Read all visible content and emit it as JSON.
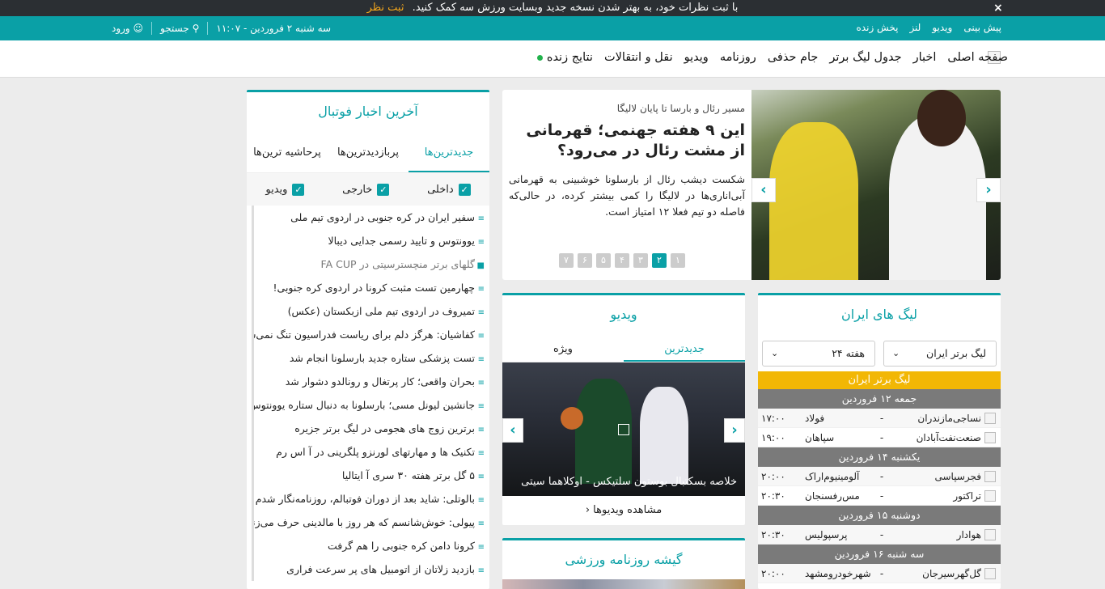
{
  "top_banner": {
    "message": "با ثبت نظرات خود، به بهتر شدن نسخه جدید وبسایت ورزش سه کمک کنید.",
    "link": "ثبت نظر",
    "close": "×"
  },
  "utility_bar": {
    "links": [
      "پیش بینی",
      "ویدیو",
      "لنز",
      "پخش زنده"
    ],
    "date_time": "سه شنبه ۲ فروردین - ۱۱:۰۷",
    "search": "جستجو",
    "login": "ورود"
  },
  "main_nav": {
    "items": [
      "صفحه اصلی",
      "اخبار",
      "جدول لیگ برتر",
      "جام حذفی",
      "روزنامه",
      "ویدیو",
      "نقل و انتقالات",
      "نتایج زنده"
    ]
  },
  "hero": {
    "kicker": "مسیر رئال و بارسا تا پایان لالیگا",
    "title": "این ۹ هفته جهنمی؛ قهرمانی از مشت رئال در می‌رود؟",
    "summary": "شکست دیشب رئال از بارسلونا خوشبینی به قهرمانی آبی‌اناری‌ها در لالیگا را کمی بیشتر کرده، در حالی‌که فاصله دو تیم فعلا ۱۲ امتیاز است.",
    "pages": [
      "۷",
      "۶",
      "۵",
      "۴",
      "۳",
      "۲",
      "۱"
    ],
    "active_page": "۲",
    "next": "›",
    "prev": "‹"
  },
  "latest_news": {
    "title": "آخرین اخبار فوتبال",
    "tabs": [
      "جدیدترین‌ها",
      "پربازدیدترین‌ها",
      "پرحاشیه ترین‌ها"
    ],
    "filters": [
      "داخلی",
      "خارجی",
      "ویدیو"
    ],
    "items": [
      {
        "text": "سفیر ایران در کره جنوبی در اردوی تیم ملی",
        "type": "text"
      },
      {
        "text": "یوونتوس و تایید رسمی جدایی دیبالا",
        "type": "text"
      },
      {
        "text": "گلهای برتر منچسترسیتی در FA CUP",
        "type": "video"
      },
      {
        "text": "چهارمین تست مثبت کرونا در اردوی کره جنوبی!",
        "type": "text"
      },
      {
        "text": "تمیروف در اردوی تیم ملی ازبکستان (عکس)",
        "type": "text"
      },
      {
        "text": "کفاشیان: هرگز دلم برای ریاست فدراسیون تنگ نمی‌شود",
        "type": "text"
      },
      {
        "text": "تست پزشکی ستاره جدید بارسلونا انجام شد",
        "type": "text"
      },
      {
        "text": "بحران واقعی؛ کار پرتغال و رونالدو دشوار شد",
        "type": "text"
      },
      {
        "text": "جانشین لیونل مسی؛ بارسلونا به دنبال ستاره یوونتوس",
        "type": "text"
      },
      {
        "text": "برترین زوج های هجومی در لیگ برتر جزیره",
        "type": "text"
      },
      {
        "text": "تکنیک ها و مهارتهای لورنزو پلگرینی در آ اس رم",
        "type": "text"
      },
      {
        "text": "۵ گل برتر هفته ۳۰ سری آ ایتالیا",
        "type": "text"
      },
      {
        "text": "بالوتلی: شاید بعد از دوران فوتبالم، روزنامه‌نگار شدم",
        "type": "text"
      },
      {
        "text": "پیولی: خوش‌شانسم که هر روز با مالدینی حرف می‌زنم",
        "type": "text"
      },
      {
        "text": "کرونا دامن کره جنوبی را هم گرفت",
        "type": "text"
      },
      {
        "text": "بازدید زلاتان از اتومبیل های پر سرعت فراری",
        "type": "text"
      }
    ]
  },
  "video": {
    "title": "ویدیو",
    "tabs": [
      "جدیدترین",
      "ویژه"
    ],
    "caption": "خلاصه بسکتبال بوستون سلتیکس - اوکلاهما سیتی",
    "more": "مشاهده ویدیوها",
    "more_arrow": "‹"
  },
  "kiosk": {
    "title": "گیشه روزنامه ورزشی"
  },
  "leagues": {
    "title": "لیگ های ایران",
    "league_select": "لیگ برتر ایران",
    "week_select": "هفته ۲۴",
    "league_name": "لیگ برتر ایران",
    "days": [
      {
        "day": "جمعه ۱۲ فروردین",
        "matches": [
          {
            "home": "نساجی‌مازندران",
            "away": "فولاد",
            "time": "۱۷:۰۰"
          },
          {
            "home": "صنعت‌نفت‌آبادان",
            "away": "سپاهان",
            "time": "۱۹:۰۰"
          }
        ]
      },
      {
        "day": "یکشنبه ۱۴ فروردین",
        "matches": [
          {
            "home": "فجرسپاسی",
            "away": "آلومینیوم‌اراک",
            "time": "۲۰:۰۰"
          },
          {
            "home": "تراکتور",
            "away": "مس‌رفسنجان",
            "time": "۲۰:۳۰"
          }
        ]
      },
      {
        "day": "دوشنبه ۱۵ فروردین",
        "matches": [
          {
            "home": "هوادار",
            "away": "پرسپولیس",
            "time": "۲۰:۳۰"
          }
        ]
      },
      {
        "day": "سه شنبه ۱۶ فروردین",
        "matches": [
          {
            "home": "گل‌گهرسیرجان",
            "away": "شهرخودرومشهد",
            "time": "۲۰:۰۰"
          }
        ]
      }
    ]
  },
  "colors": {
    "brand": "#0aa0a6",
    "banner": "#2b2f33",
    "league_header": "#f2b705",
    "day_header": "#7a7a7a"
  }
}
